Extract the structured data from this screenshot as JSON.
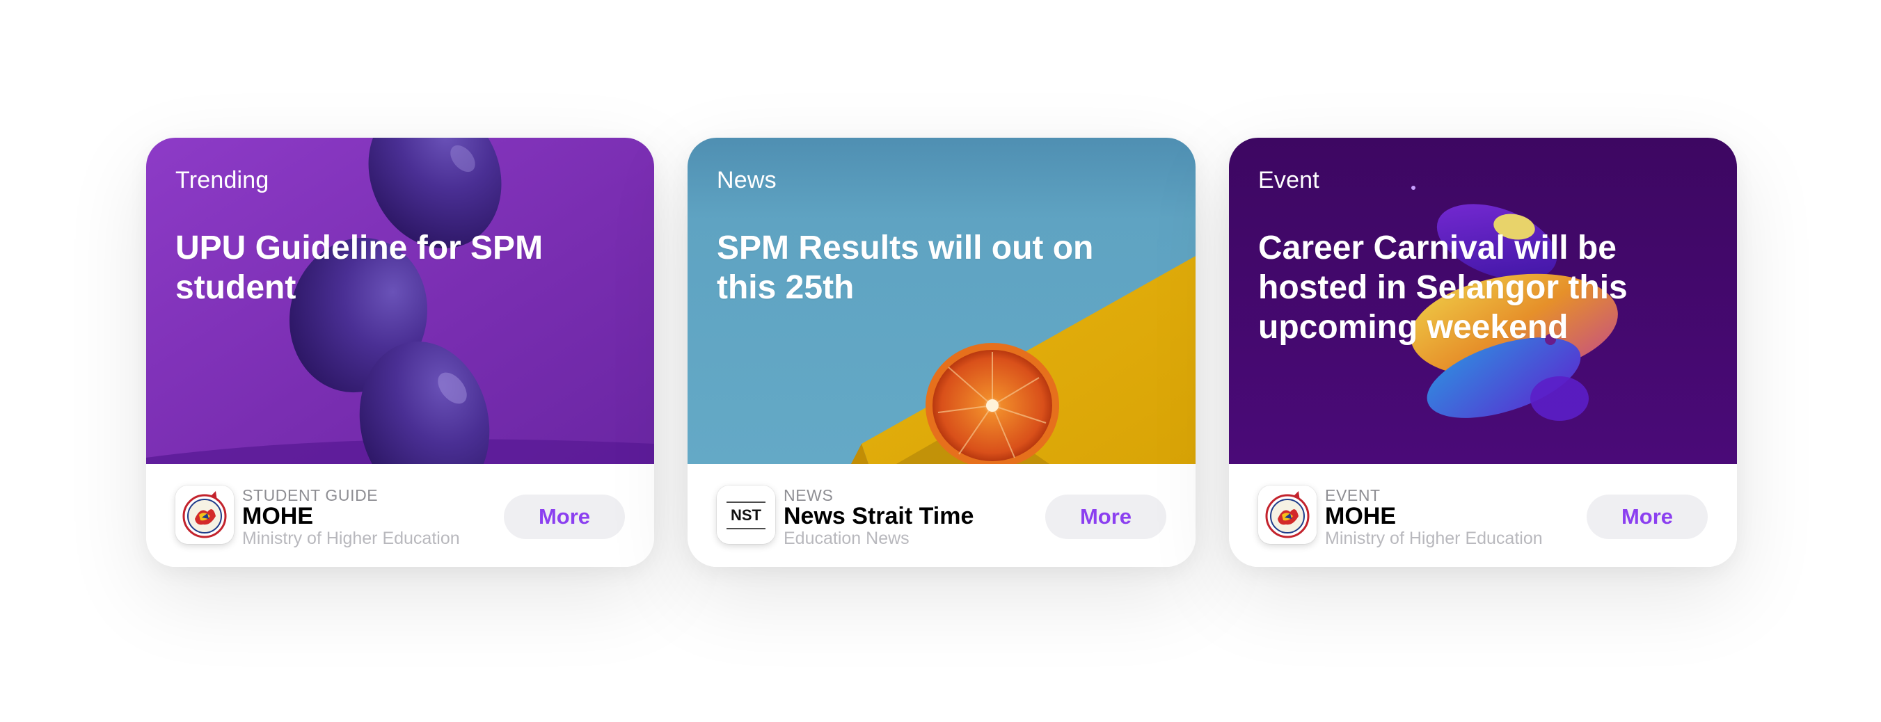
{
  "cards": [
    {
      "category": "Trending",
      "headline": "UPU Guideline for SPM student",
      "publisher": {
        "kicker": "STUDENT GUIDE",
        "name": "MOHE",
        "subtitle": "Ministry of Higher Education",
        "logo_icon": "mohe-crest-icon"
      },
      "button_label": "More"
    },
    {
      "category": "News",
      "headline": "SPM Results will out on this 25th",
      "publisher": {
        "kicker": "NEWS",
        "name": "News Strait Time",
        "subtitle": "Education News",
        "logo_icon": "nst-logo-icon",
        "logo_text": "NST"
      },
      "button_label": "More"
    },
    {
      "category": "Event",
      "headline": "Career Carnival will be hosted in Selangor this upcoming weekend",
      "publisher": {
        "kicker": "EVENT",
        "name": "MOHE",
        "subtitle": "Ministry of Higher Education",
        "logo_icon": "mohe-crest-icon"
      },
      "button_label": "More"
    }
  ],
  "colors": {
    "accent": "#8b3ff0",
    "button_bg": "#efeff2",
    "card_1_bg": "#7e34b8",
    "card_2_bg": "#5fa3c2",
    "card_3_bg": "#44086f"
  }
}
